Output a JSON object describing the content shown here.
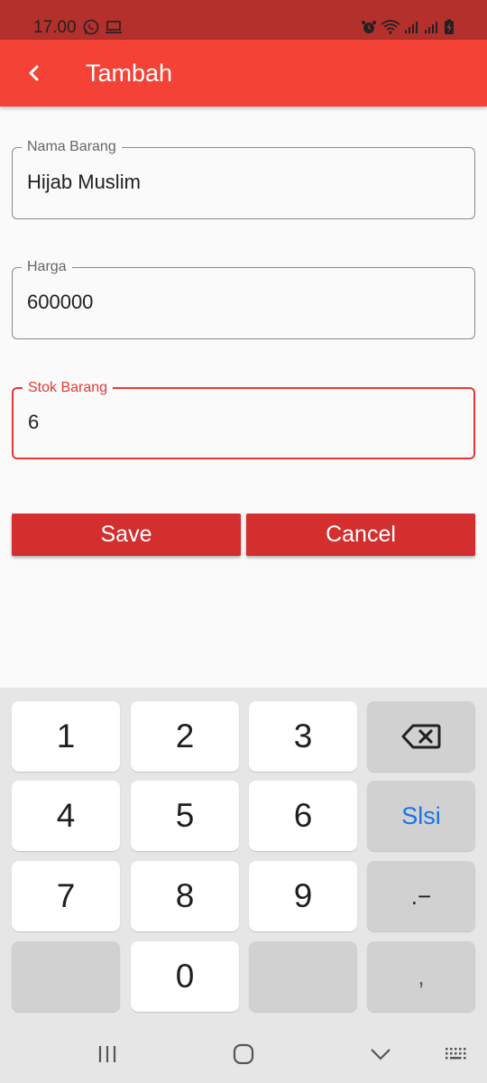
{
  "status_bar": {
    "time": "17.00",
    "left_icons": [
      "whatsapp-icon",
      "laptop-icon"
    ],
    "right_icons": [
      "alarm-icon",
      "wifi-icon",
      "signal-icon",
      "signal-icon",
      "battery-charging-icon"
    ]
  },
  "app_bar": {
    "title": "Tambah",
    "back_icon": "chevron-left-icon",
    "background": "#f44336"
  },
  "form": {
    "fields": [
      {
        "label": "Nama Barang",
        "value": "Hijab Muslim"
      },
      {
        "label": "Harga",
        "value": "600000"
      },
      {
        "label": "Stok Barang",
        "value": "6",
        "focused": true
      }
    ],
    "save_label": "Save",
    "cancel_label": "Cancel",
    "button_color": "#d32f2f",
    "focus_color": "#e53935"
  },
  "keyboard": {
    "keys": [
      "1",
      "2",
      "3",
      "4",
      "5",
      "6",
      "Slsi",
      "7",
      "8",
      "9",
      ".−",
      "0",
      ","
    ],
    "backspace_icon": "backspace-icon"
  },
  "nav_bar": {
    "icons": [
      "recent-apps-icon",
      "home-icon",
      "back-chevron-icon",
      "keyboard-toggle-icon"
    ]
  }
}
